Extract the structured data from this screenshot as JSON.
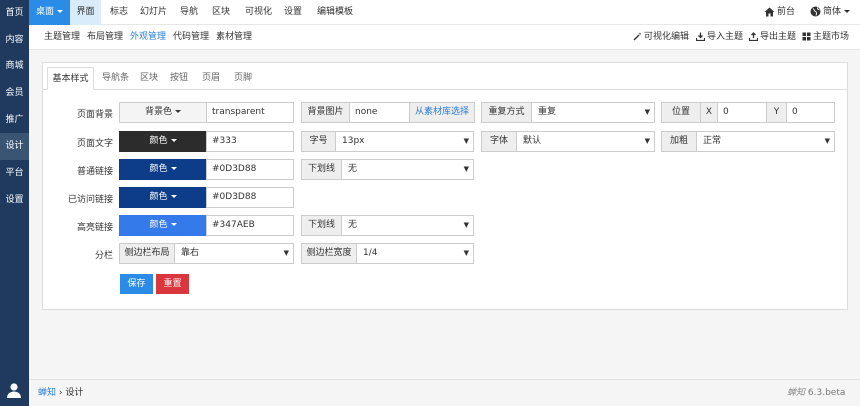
{
  "left_nav": [
    "首页",
    "内容",
    "商城",
    "会员",
    "推广",
    "设计",
    "平台",
    "设置"
  ],
  "top_nav": {
    "items": [
      "桌面",
      "界面",
      "标志",
      "幻灯片",
      "导航",
      "区块",
      "可视化",
      "设置",
      "编辑模板"
    ],
    "front": "前台",
    "lang": "简体"
  },
  "sub_nav": {
    "items": [
      "主题管理",
      "布局管理",
      "外观管理",
      "代码管理",
      "素材管理"
    ],
    "right": [
      "可视化编辑",
      "导入主题",
      "导出主题",
      "主题市场"
    ]
  },
  "tabs": [
    "基本样式",
    "导航条",
    "区块",
    "按钮",
    "页眉",
    "页脚"
  ],
  "form": {
    "row1": {
      "label": "页面背景",
      "bg_btn": "背景色",
      "bg_value": "transparent",
      "img_label": "背景图片",
      "img_value": "none",
      "img_lib": "从素材库选择",
      "repeat_label": "重复方式",
      "repeat_value": "重复",
      "pos_label": "位置",
      "x_label": "X",
      "x_value": "0",
      "y_label": "Y",
      "y_value": "0"
    },
    "row2": {
      "label": "页面文字",
      "color_btn": "颜色",
      "color_value": "#333",
      "size_label": "字号",
      "size_value": "13px",
      "font_label": "字体",
      "font_value": "默认",
      "bold_label": "加粗",
      "bold_value": "正常"
    },
    "row3": {
      "label": "普通链接",
      "color_btn": "颜色",
      "color_value": "#0D3D88",
      "ul_label": "下划线",
      "ul_value": "无"
    },
    "row4": {
      "label": "已访问链接",
      "color_btn": "颜色",
      "color_value": "#0D3D88"
    },
    "row5": {
      "label": "高亮链接",
      "color_btn": "颜色",
      "color_value": "#347AEB",
      "ul_label": "下划线",
      "ul_value": "无"
    },
    "row6": {
      "label": "分栏",
      "sb_label": "侧边栏布局",
      "sb_value": "靠右",
      "sbw_label": "侧边栏宽度",
      "sbw_value": "1/4"
    },
    "save": "保存",
    "reset": "重置"
  },
  "footer": {
    "crumb1": "蝉知",
    "crumb2": "设计",
    "version": "6.3.beta",
    "brand": "蝉知"
  },
  "colors": {
    "text_swatch": "#2c2c2c",
    "link_swatch": "#0D3D88",
    "visited_swatch": "#0D3D88",
    "hover_swatch": "#347AEB",
    "save": "#2a8ce6",
    "reset": "#d9363e",
    "sidebar": "#1f3a5e"
  }
}
